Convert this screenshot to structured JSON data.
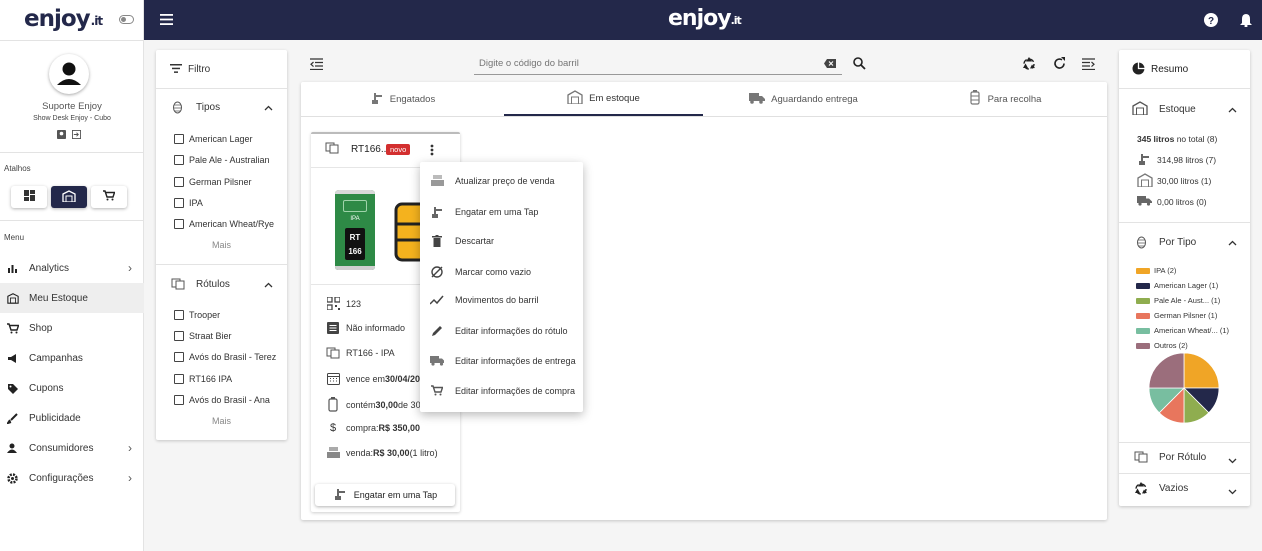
{
  "app": {
    "logo": "enjoy",
    "logo_suffix": ".it",
    "brand_color": "#23284a"
  },
  "user": {
    "name": "Suporte Enjoy",
    "place": "Show Desk Enjoy - Cubo"
  },
  "sidebar": {
    "atalhos_label": "Atalhos",
    "menu_label": "Menu",
    "items": [
      {
        "label": "Analytics",
        "icon": "bar-chart-icon",
        "chevron": "›"
      },
      {
        "label": "Meu Estoque",
        "icon": "warehouse-icon",
        "chevron": ""
      },
      {
        "label": "Shop",
        "icon": "cart-icon",
        "chevron": ""
      },
      {
        "label": "Campanhas",
        "icon": "megaphone-icon",
        "chevron": ""
      },
      {
        "label": "Cupons",
        "icon": "tag-icon",
        "chevron": ""
      },
      {
        "label": "Publicidade",
        "icon": "brush-icon",
        "chevron": ""
      },
      {
        "label": "Consumidores",
        "icon": "person-icon",
        "chevron": "›"
      },
      {
        "label": "Configurações",
        "icon": "gear-icon",
        "chevron": "›"
      }
    ]
  },
  "filter": {
    "title": "Filtro",
    "tipos_title": "Tipos",
    "tipos": [
      "American Lager",
      "Pale Ale - Australian",
      "German Pilsner",
      "IPA",
      "American Wheat/Rye"
    ],
    "rotulos_title": "Rótulos",
    "rotulos": [
      "Trooper",
      "Straat Bier",
      "Avós do Brasil - Terez",
      "RT166 IPA",
      "Avós do Brasil - Ana"
    ],
    "more_label": "Mais"
  },
  "search": {
    "placeholder": "Digite o código do barril"
  },
  "tabs": [
    {
      "label": "Engatados",
      "icon": "tap-icon"
    },
    {
      "label": "Em estoque",
      "icon": "warehouse-icon"
    },
    {
      "label": "Aguardando entrega",
      "icon": "truck-icon"
    },
    {
      "label": "Para recolha",
      "icon": "keg-icon"
    }
  ],
  "barrel": {
    "name": "RT166...",
    "badge": "novo",
    "can_label": "IPA",
    "can_brand": "RT 166",
    "code": "123",
    "info": "Não informado",
    "product": "RT166 - IPA",
    "expires_prefix": "vence em ",
    "expires": "30/04/20",
    "contains_prefix": "contém ",
    "contains": "30,00",
    "contains_suffix": " de 30",
    "purchase_prefix": "compra: ",
    "purchase": "R$ 350,00",
    "sale_prefix": "venda: ",
    "sale": "R$ 30,00",
    "sale_suffix": " (1 litro)",
    "action": "Engatar em uma Tap"
  },
  "context_menu": [
    "Atualizar preço de venda",
    "Engatar em uma Tap",
    "Descartar",
    "Marcar como vazio",
    "Movimentos do barril",
    "Editar informações do rótulo",
    "Editar informações de entrega",
    "Editar informações de compra"
  ],
  "resumo": {
    "title": "Resumo",
    "estoque_title": "Estoque",
    "total_bold": "345 litros",
    "total_rest": " no total (8)",
    "lines": [
      "314,98 litros (7)",
      "30,00 litros (1)",
      "0,00 litros (0)"
    ],
    "tipo_title": "Por Tipo",
    "legend": [
      {
        "label": "IPA (2)",
        "color": "#f0a526"
      },
      {
        "label": "American Lager (1)",
        "color": "#23284a"
      },
      {
        "label": "Pale Ale - Aust... (1)",
        "color": "#8fad4f"
      },
      {
        "label": "German Pilsner (1)",
        "color": "#e8765d"
      },
      {
        "label": "American Wheat/... (1)",
        "color": "#78bea0"
      },
      {
        "label": "Outros (2)",
        "color": "#9b6e7c"
      }
    ],
    "pie": [
      2,
      1,
      1,
      1,
      1,
      2
    ],
    "rotulo_title": "Por Rótulo",
    "vazios_title": "Vazios"
  }
}
